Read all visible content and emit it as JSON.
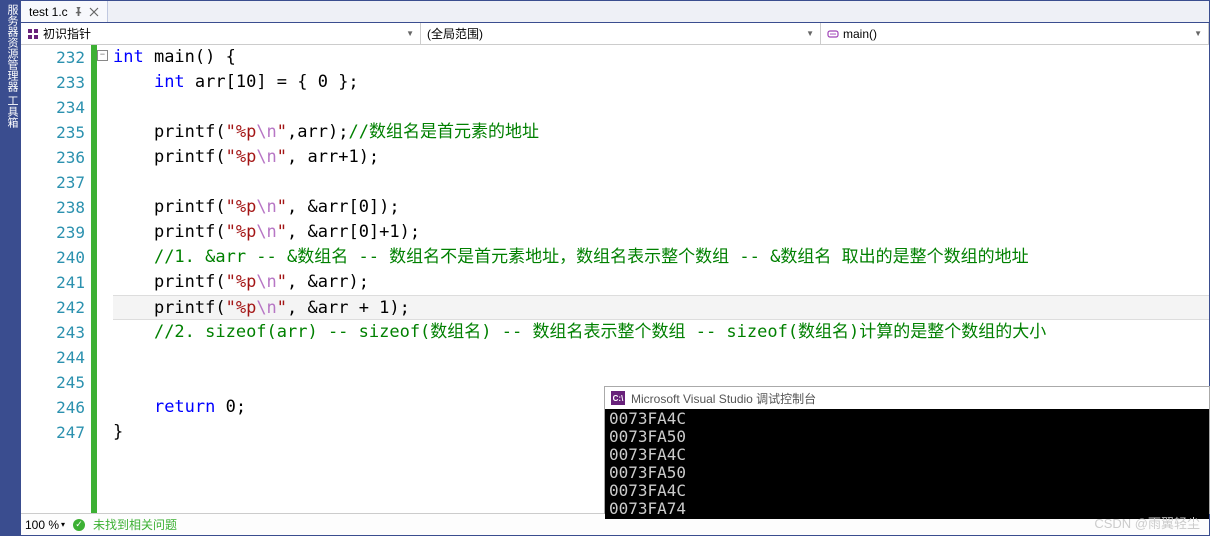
{
  "vertical_toolbar": "服务器资源管理器 工具箱",
  "tab": {
    "filename": "test 1.c"
  },
  "dropdowns": {
    "scope": "初识指针",
    "context": "(全局范围)",
    "member": "main()"
  },
  "gutter": {
    "start": 232,
    "end": 247
  },
  "code": {
    "lines": [
      {
        "n": 232,
        "raw": "int main() {",
        "tokens": [
          [
            "kw",
            "int"
          ],
          [
            "",
            " main() {"
          ]
        ]
      },
      {
        "n": 233,
        "raw": "    int arr[10] = { 0 };",
        "tokens": [
          [
            "",
            "    "
          ],
          [
            "kw",
            "int"
          ],
          [
            "",
            " arr[10] = { 0 };"
          ]
        ]
      },
      {
        "n": 234,
        "raw": "",
        "tokens": []
      },
      {
        "n": 235,
        "raw": "    printf(\"%p\\n\",arr);//数组名是首元素的地址",
        "tokens": [
          [
            "",
            "    printf("
          ],
          [
            "str",
            "\"%p"
          ],
          [
            "esc",
            "\\n"
          ],
          [
            "str",
            "\""
          ],
          [
            "",
            ",arr);"
          ],
          [
            "cmt",
            "//数组名是首元素的地址"
          ]
        ]
      },
      {
        "n": 236,
        "raw": "    printf(\"%p\\n\", arr+1);",
        "tokens": [
          [
            "",
            "    printf("
          ],
          [
            "str",
            "\"%p"
          ],
          [
            "esc",
            "\\n"
          ],
          [
            "str",
            "\""
          ],
          [
            "",
            ", arr+1);"
          ]
        ]
      },
      {
        "n": 237,
        "raw": "",
        "tokens": []
      },
      {
        "n": 238,
        "raw": "    printf(\"%p\\n\", &arr[0]);",
        "tokens": [
          [
            "",
            "    printf("
          ],
          [
            "str",
            "\"%p"
          ],
          [
            "esc",
            "\\n"
          ],
          [
            "str",
            "\""
          ],
          [
            "",
            ", &arr[0]);"
          ]
        ]
      },
      {
        "n": 239,
        "raw": "    printf(\"%p\\n\", &arr[0]+1);",
        "tokens": [
          [
            "",
            "    printf("
          ],
          [
            "str",
            "\"%p"
          ],
          [
            "esc",
            "\\n"
          ],
          [
            "str",
            "\""
          ],
          [
            "",
            ", &arr[0]+1);"
          ]
        ]
      },
      {
        "n": 240,
        "raw": "    //1. &arr -- &数组名 -- 数组名不是首元素地址，数组名表示整个数组 -- &数组名 取出的是整个数组的地址",
        "tokens": [
          [
            "",
            "    "
          ],
          [
            "cmt",
            "//1. &arr -- &数组名 -- 数组名不是首元素地址，数组名表示整个数组 -- &数组名 取出的是整个数组的地址"
          ]
        ]
      },
      {
        "n": 241,
        "raw": "    printf(\"%p\\n\", &arr);",
        "tokens": [
          [
            "",
            "    printf("
          ],
          [
            "str",
            "\"%p"
          ],
          [
            "esc",
            "\\n"
          ],
          [
            "str",
            "\""
          ],
          [
            "",
            ", &arr);"
          ]
        ]
      },
      {
        "n": 242,
        "raw": "    printf(\"%p\\n\", &arr + 1);",
        "tokens": [
          [
            "",
            "    printf("
          ],
          [
            "str",
            "\"%p"
          ],
          [
            "esc",
            "\\n"
          ],
          [
            "str",
            "\""
          ],
          [
            "",
            ", &arr + 1);"
          ]
        ],
        "highlight": true
      },
      {
        "n": 243,
        "raw": "    //2. sizeof(arr) -- sizeof(数组名) -- 数组名表示整个数组 -- sizeof(数组名)计算的是整个数组的大小",
        "tokens": [
          [
            "",
            "    "
          ],
          [
            "cmt",
            "//2. sizeof(arr) -- sizeof(数组名) -- 数组名表示整个数组 -- sizeof(数组名)计算的是整个数组的大小"
          ]
        ]
      },
      {
        "n": 244,
        "raw": "",
        "tokens": []
      },
      {
        "n": 245,
        "raw": "",
        "tokens": []
      },
      {
        "n": 246,
        "raw": "    return 0;",
        "tokens": [
          [
            "",
            "    "
          ],
          [
            "kw",
            "return"
          ],
          [
            "",
            " 0;"
          ]
        ]
      },
      {
        "n": 247,
        "raw": "}",
        "tokens": [
          [
            "",
            "}"
          ]
        ]
      }
    ]
  },
  "status": {
    "zoom": "100 %",
    "issues": "未找到相关问题"
  },
  "console": {
    "title": "Microsoft Visual Studio 调试控制台",
    "lines": [
      "0073FA4C",
      "0073FA50",
      "0073FA4C",
      "0073FA50",
      "0073FA4C",
      "0073FA74"
    ]
  },
  "watermark": "CSDN @雨翼轻尘"
}
